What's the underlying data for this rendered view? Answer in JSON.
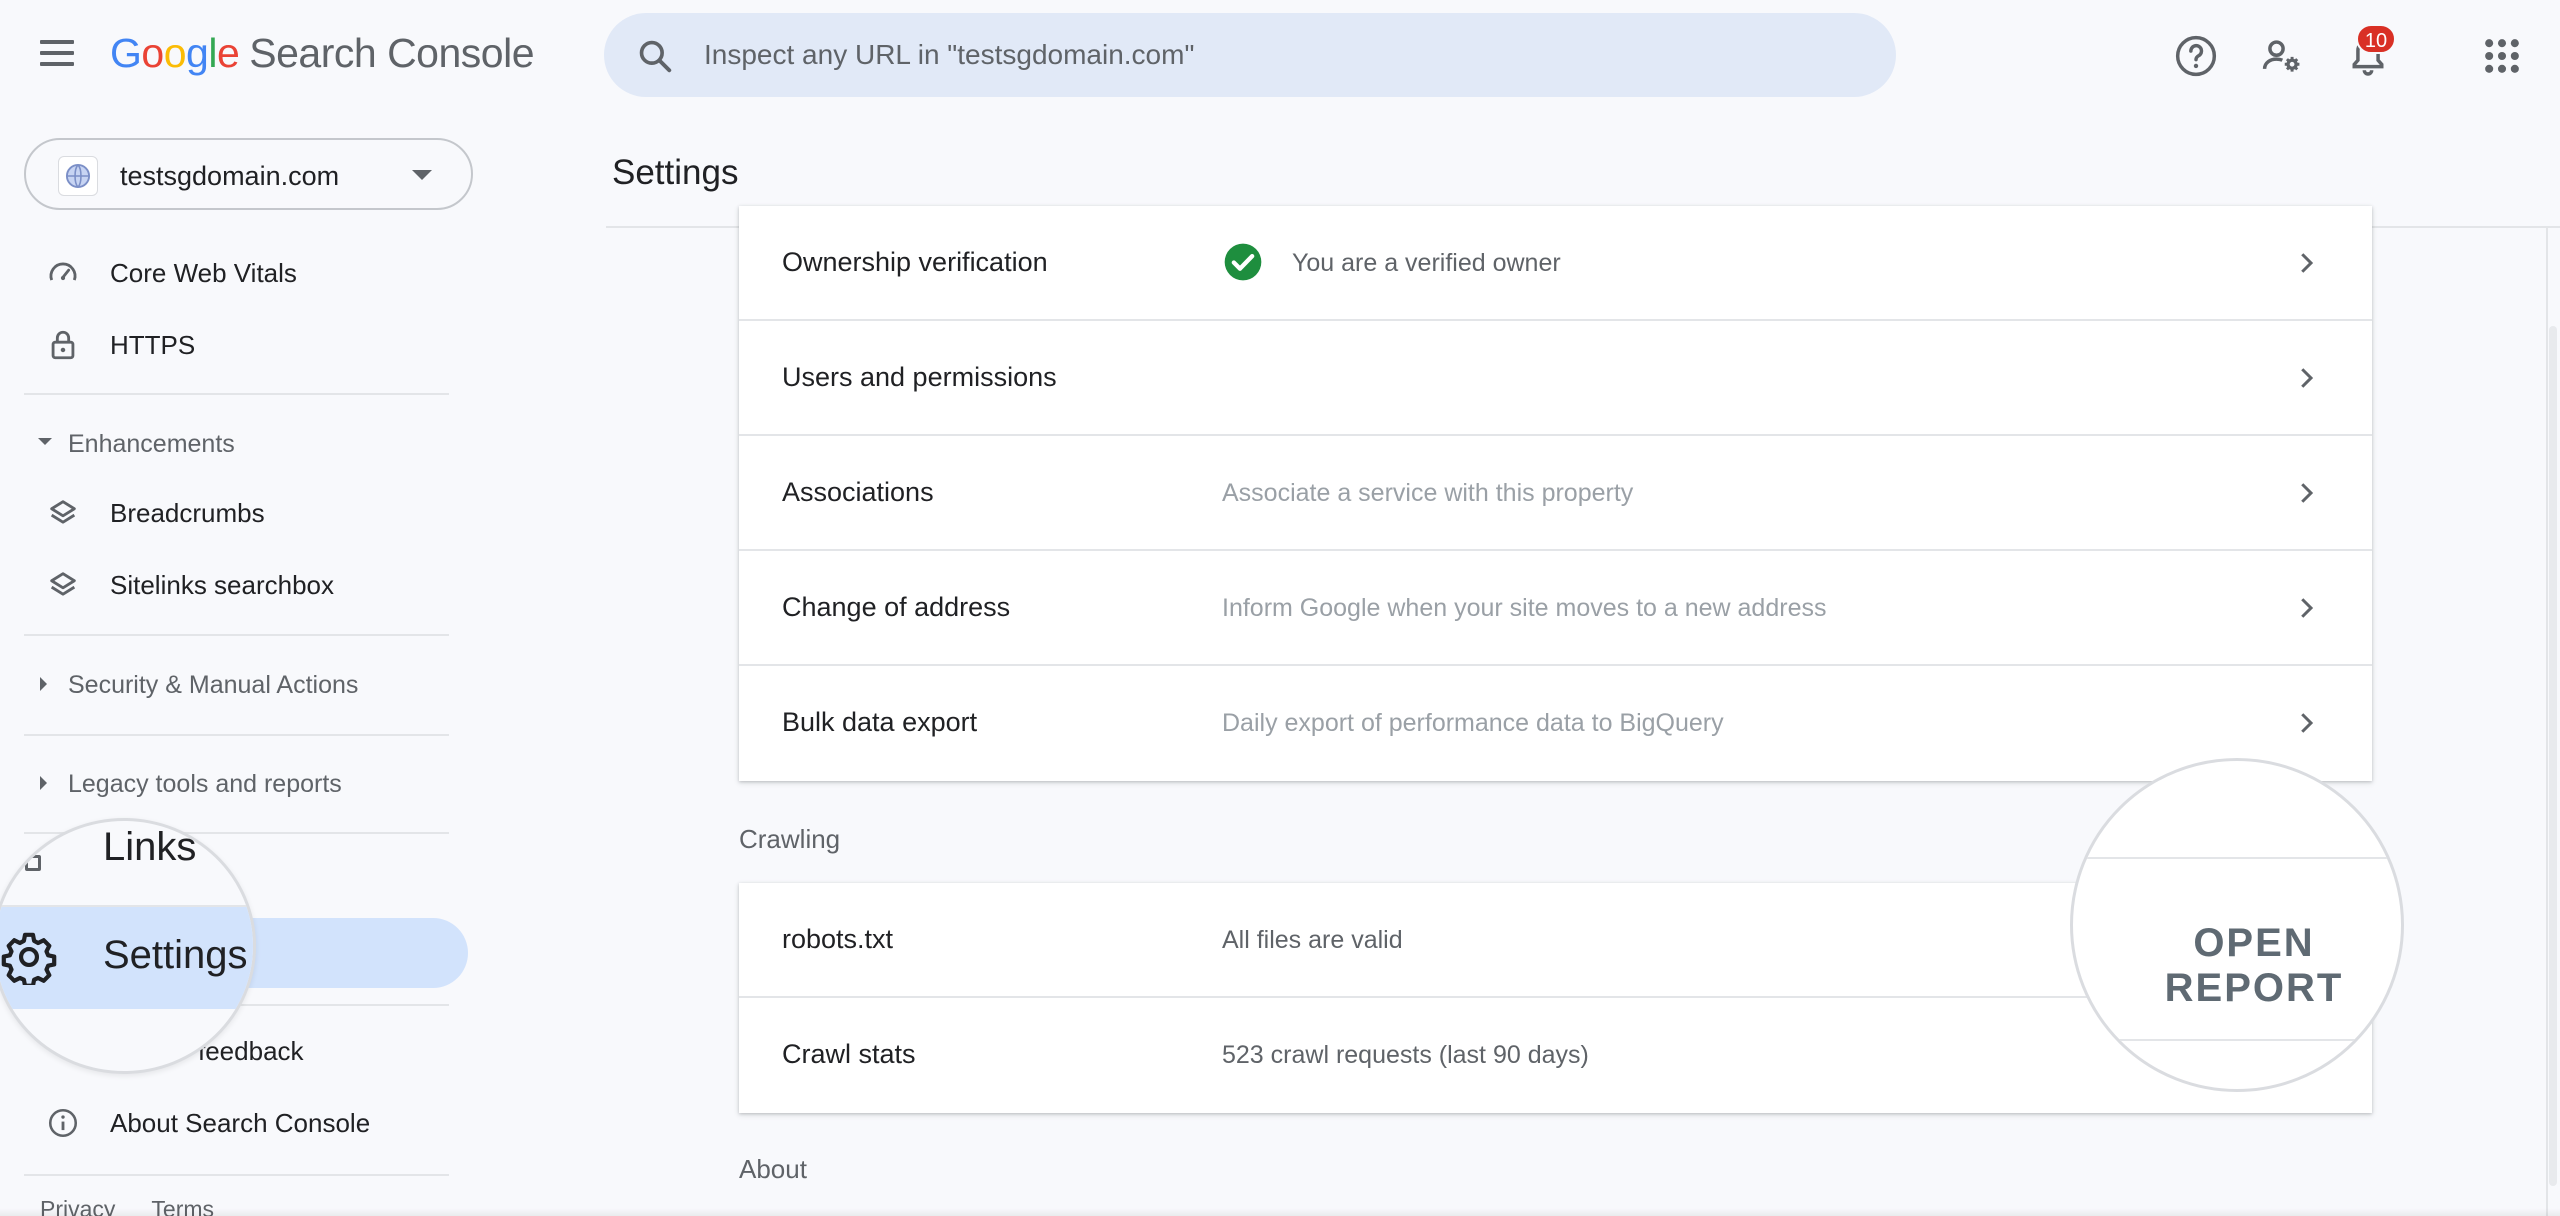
{
  "header": {
    "logo_letters": [
      "G",
      "o",
      "o",
      "g",
      "l",
      "e"
    ],
    "product_name": "Search Console",
    "search_placeholder": "Inspect any URL in \"testsgdomain.com\"",
    "notification_count": "10"
  },
  "property": {
    "label": "testsgdomain.com"
  },
  "sidebar": {
    "items_top": [
      {
        "label": "Core Web Vitals",
        "icon": "speedometer-icon"
      },
      {
        "label": "HTTPS",
        "icon": "lock-icon"
      }
    ],
    "enhancements": {
      "label": "Enhancements",
      "items": [
        {
          "label": "Breadcrumbs",
          "icon": "layers-icon"
        },
        {
          "label": "Sitelinks searchbox",
          "icon": "layers-icon"
        }
      ]
    },
    "security_label": "Security & Manual Actions",
    "legacy_label": "Legacy tools and reports",
    "links_label": "Links",
    "settings_label": "Settings",
    "feedback_label": "feedback",
    "about_label": "About Search Console",
    "footer": {
      "privacy": "Privacy",
      "terms": "Terms"
    }
  },
  "main": {
    "title": "Settings",
    "general_rows": [
      {
        "title": "Ownership verification",
        "desc": "You are a verified owner",
        "verified": true
      },
      {
        "title": "Users and permissions",
        "desc": ""
      },
      {
        "title": "Associations",
        "desc": "Associate a service with this property"
      },
      {
        "title": "Change of address",
        "desc": "Inform Google when your site moves to a new address"
      },
      {
        "title": "Bulk data export",
        "desc": "Daily export of performance data to BigQuery"
      }
    ],
    "crawling_label": "Crawling",
    "crawling_rows": [
      {
        "title": "robots.txt",
        "desc": "All files are valid"
      },
      {
        "title": "Crawl stats",
        "desc": "523 crawl requests (last 90 days)"
      }
    ],
    "open_report_label": "OPEN REPORT",
    "about_label": "About"
  },
  "colors": {
    "accent_active": "#d2e3fc",
    "verified_green": "#1e8e3e",
    "badge_red": "#d93025"
  }
}
